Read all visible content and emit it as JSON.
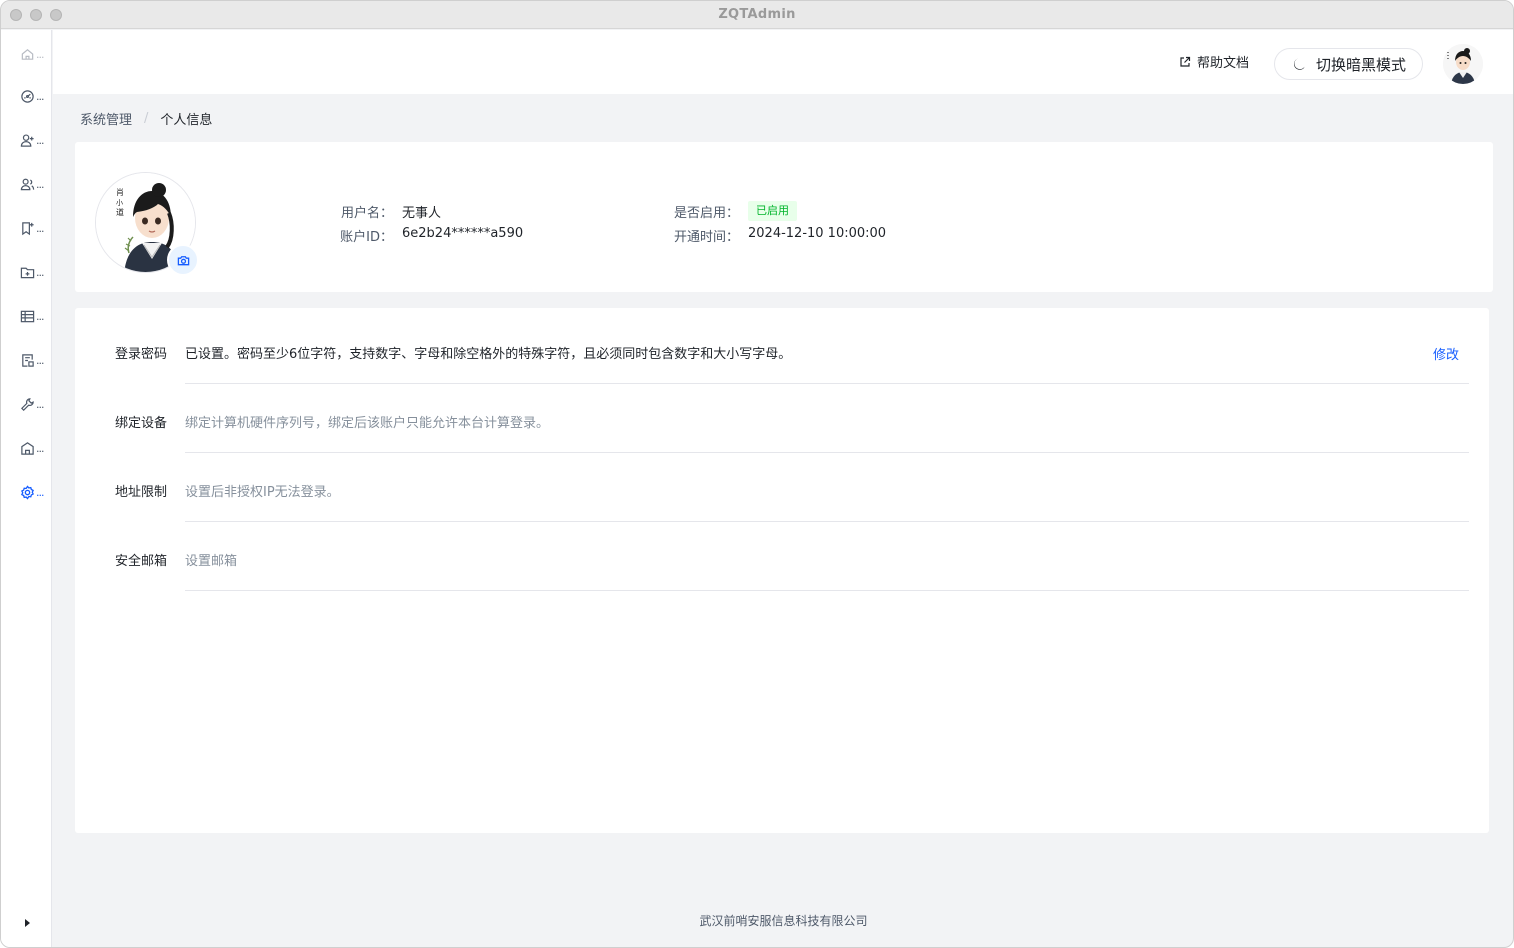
{
  "window": {
    "title": "ZQTAdmin"
  },
  "header": {
    "help_label": "帮助文档",
    "dark_mode_label": "切换暗黑模式"
  },
  "breadcrumb": [
    "系统管理",
    "个人信息"
  ],
  "profile": {
    "username_label": "用户名：",
    "username": "无事人",
    "account_id_label": "账户ID：",
    "account_id": "6e2b24******a590",
    "enabled_label": "是否启用：",
    "enabled_status": "已启用",
    "open_time_label": "开通时间：",
    "open_time": "2024-12-10 10:00:00"
  },
  "security": [
    {
      "label": "登录密码",
      "desc": "已设置。密码至少6位字符，支持数字、字母和除空格外的特殊字符，且必须同时包含数字和大小写字母。",
      "action": "修改",
      "set": true
    },
    {
      "label": "绑定设备",
      "desc": "绑定计算机硬件序列号，绑定后该账户只能允许本台计算登录。",
      "action": "",
      "set": false
    },
    {
      "label": "地址限制",
      "desc": "设置后非授权IP无法登录。",
      "action": "",
      "set": false
    },
    {
      "label": "安全邮箱",
      "desc": "设置邮箱",
      "action": "",
      "set": false
    }
  ],
  "sidebar": {
    "items": [
      {
        "icon": "home-icon",
        "state": "dim"
      },
      {
        "icon": "dashboard-icon",
        "state": "normal"
      },
      {
        "icon": "user-add-icon",
        "state": "normal"
      },
      {
        "icon": "users-icon",
        "state": "normal"
      },
      {
        "icon": "bookmark-add-icon",
        "state": "normal"
      },
      {
        "icon": "folder-add-icon",
        "state": "normal"
      },
      {
        "icon": "table-icon",
        "state": "normal"
      },
      {
        "icon": "form-icon",
        "state": "normal"
      },
      {
        "icon": "tool-icon",
        "state": "normal"
      },
      {
        "icon": "building-icon",
        "state": "normal"
      },
      {
        "icon": "settings-icon",
        "state": "active"
      }
    ],
    "ellipsis": "..."
  },
  "footer": {
    "company": "武汉前哨安服信息科技有限公司"
  },
  "colors": {
    "accent": "#165dff",
    "success": "#00b42a",
    "success_bg": "#e8ffea"
  }
}
